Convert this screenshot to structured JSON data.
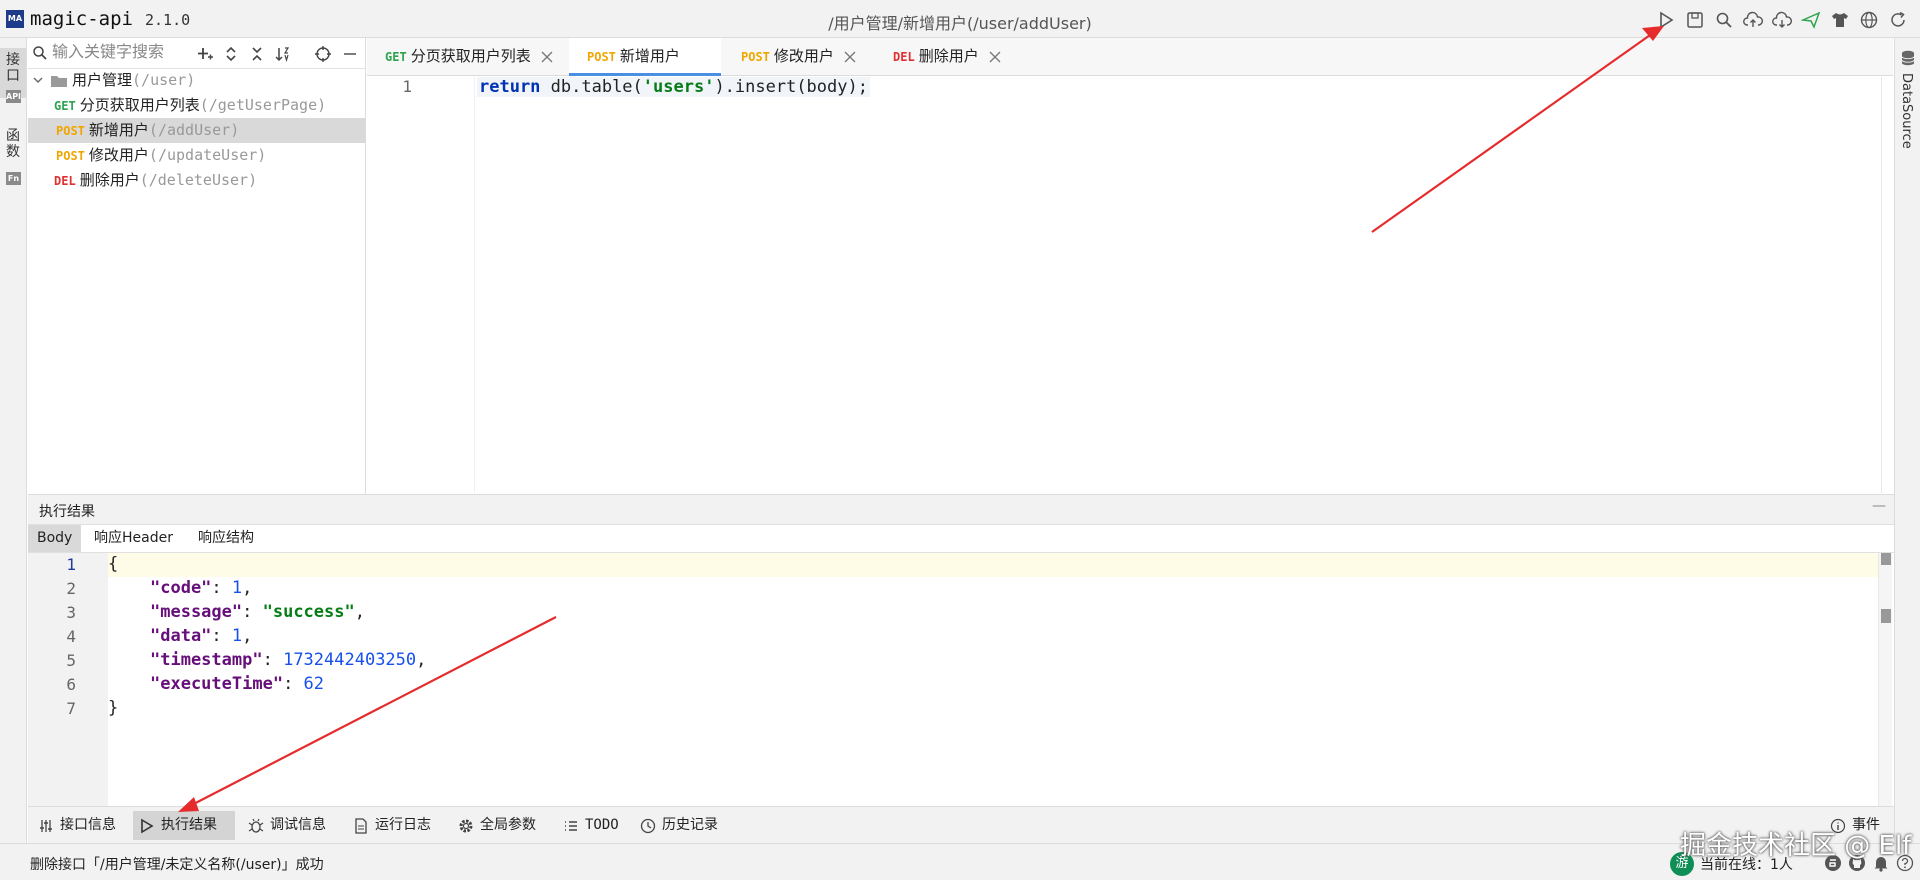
{
  "app": {
    "name": "magic-api",
    "version": "2.1.0",
    "logo_text": "MA",
    "title_path": "/用户管理/新增用户(/user/addUser)"
  },
  "toolbar": [
    "play-icon",
    "save-icon",
    "search-icon",
    "upload-icon",
    "download-icon",
    "send-icon",
    "skin-icon",
    "globe-icon",
    "refresh-icon"
  ],
  "left_strip": {
    "tab_api": "接口",
    "tab_func": "函数",
    "icon_api": "API",
    "icon_fn": "Fn"
  },
  "search": {
    "placeholder": "输入关键字搜索"
  },
  "tree": {
    "group": {
      "name": "用户管理",
      "path": "(/user)"
    },
    "items": [
      {
        "method": "GET",
        "name": "分页获取用户列表",
        "path": "(/getUserPage)"
      },
      {
        "method": "POST",
        "name": "新增用户",
        "path": "(/addUser)"
      },
      {
        "method": "POST",
        "name": "修改用户",
        "path": "(/updateUser)"
      },
      {
        "method": "DEL",
        "name": "删除用户",
        "path": "(/deleteUser)"
      }
    ]
  },
  "tabs": [
    {
      "method": "GET",
      "name": "分页获取用户列表"
    },
    {
      "method": "POST",
      "name": "新增用户"
    },
    {
      "method": "POST",
      "name": "修改用户"
    },
    {
      "method": "DEL",
      "name": "删除用户"
    }
  ],
  "editor": {
    "line_no": "1",
    "code": {
      "kw": "return",
      "pre": " db.table(",
      "str": "'users'",
      "post": ").insert(body);"
    }
  },
  "right_strip": {
    "label": "DataSource"
  },
  "results": {
    "title": "执行结果",
    "minimize": "—",
    "subtabs": [
      "Body",
      "响应Header",
      "响应结构"
    ],
    "line_numbers": [
      "1",
      "2",
      "3",
      "4",
      "5",
      "6",
      "7"
    ],
    "json": {
      "open": "{",
      "close": "}",
      "k1": "\"code\"",
      "v1": "1",
      "k2": "\"message\"",
      "v2": "\"success\"",
      "k3": "\"data\"",
      "v3": "1",
      "k4": "\"timestamp\"",
      "v4": "1732442403250",
      "k5": "\"executeTime\"",
      "v5": "62",
      "colon": ": ",
      "comma": ","
    }
  },
  "bottom_tabs": [
    "接口信息",
    "执行结果",
    "调试信息",
    "运行日志",
    "全局参数",
    "TODO",
    "历史记录"
  ],
  "bottom_right": {
    "label": "事件"
  },
  "status": {
    "message": "删除接口「/用户管理/未定义名称(/user)」成功",
    "online_badge": "游",
    "online_text": "当前在线：1人"
  },
  "watermark": "掘金技术社区 @ Elf",
  "colors": {
    "get": "#2ea44f",
    "post": "#f0a500",
    "del": "#e03030",
    "arrow": "#e52b2b",
    "accent": "#4a90e2"
  }
}
